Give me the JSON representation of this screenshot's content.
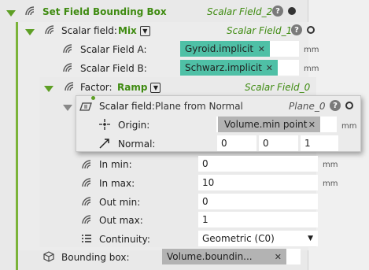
{
  "root": {
    "title": "Set Field Bounding Box",
    "instance": "Scalar Field_2"
  },
  "mix": {
    "label": "Scalar field:",
    "type": "Mix",
    "instance": "Scalar Field_1",
    "field_a_label": "Scalar Field A:",
    "field_a_value": "Gyroid.implicit",
    "field_b_label": "Scalar Field B:",
    "field_b_value": "Schwarz.implicit"
  },
  "ramp": {
    "label": "Factor:",
    "type": "Ramp",
    "instance": "Scalar Field_0"
  },
  "plane": {
    "label": "Scalar field:",
    "type": "Plane from Normal",
    "instance": "Plane_0",
    "origin_label": "Origin:",
    "origin_value": "Volume.min point",
    "normal_label": "Normal:",
    "normal_x": "0",
    "normal_y": "0",
    "normal_z": "1"
  },
  "ramp_params": {
    "in_min_label": "In min:",
    "in_min": "0",
    "in_max_label": "In max:",
    "in_max": "10",
    "out_min_label": "Out min:",
    "out_min": "0",
    "out_max_label": "Out max:",
    "out_max": "1",
    "continuity_label": "Continuity:",
    "continuity": "Geometric (C0)"
  },
  "bbox": {
    "label": "Bounding box:",
    "value": "Volume.boundin..."
  },
  "units": {
    "mm": "mm"
  },
  "help_glyph": "?",
  "chip_close": "✕",
  "dropdown_glyph": "▼",
  "colors": {
    "accent_green": "#3f8b11",
    "chip_teal": "#4fc0a6",
    "chip_grey": "#b3b3b3"
  }
}
